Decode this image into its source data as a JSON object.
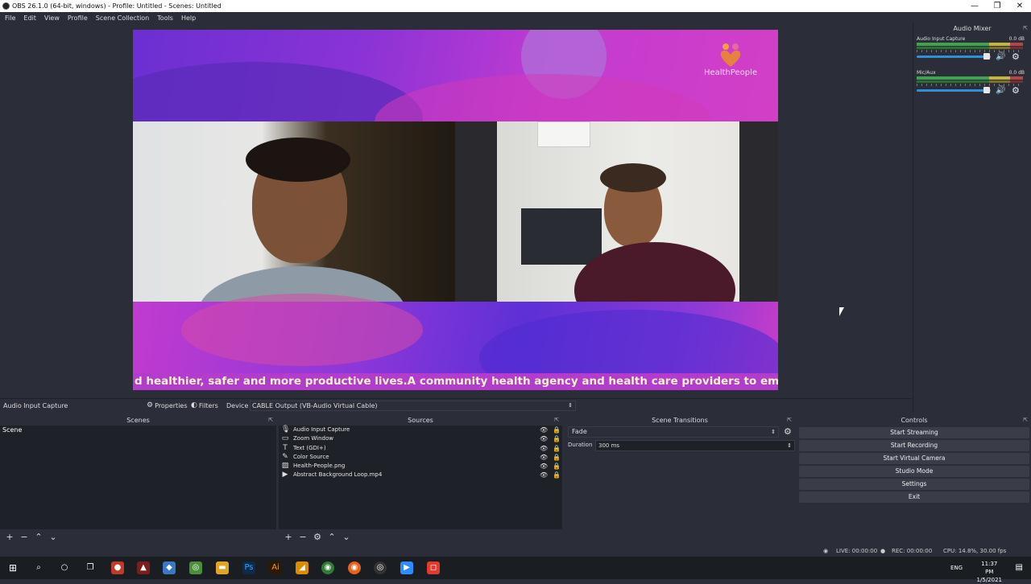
{
  "window": {
    "title": "OBS 26.1.0 (64-bit, windows) - Profile: Untitled - Scenes: Untitled",
    "controls": {
      "minimize": "—",
      "restore": "❐",
      "close": "✕"
    }
  },
  "menu": [
    "File",
    "Edit",
    "View",
    "Profile",
    "Scene Collection",
    "Tools",
    "Help"
  ],
  "preview": {
    "ticker_text": "d healthier, safer and more productive lives.A community health agency and health care providers to empowe",
    "logo_text": "HealthPeople",
    "colors": {
      "purple": "#7a2fd0",
      "magenta": "#d33fc6",
      "ticker_text": "#f4f4c8"
    }
  },
  "audio_mixer": {
    "title": "Audio Mixer",
    "channels": [
      {
        "name": "Audio Input Capture",
        "db": "0.0 dB",
        "volume_icon": "speaker-icon",
        "settings_icon": "gear-icon"
      },
      {
        "name": "Mic/Aux",
        "db": "0.0 dB",
        "volume_icon": "speaker-icon",
        "settings_icon": "gear-icon"
      }
    ]
  },
  "source_toolbar": {
    "selected_source": "Audio Input Capture",
    "properties_label": "Properties",
    "filters_label": "Filters",
    "device_label": "Device",
    "device_value": "CABLE Output (VB-Audio Virtual Cable)"
  },
  "scenes": {
    "title": "Scenes",
    "items": [
      "Scene"
    ]
  },
  "sources": {
    "title": "Sources",
    "items": [
      {
        "label": "Audio Input Capture",
        "icon": "microphone-icon"
      },
      {
        "label": "Zoom Window",
        "icon": "window-icon"
      },
      {
        "label": "Text (GDI+)",
        "icon": "text-icon"
      },
      {
        "label": "Color Source",
        "icon": "paintbrush-icon"
      },
      {
        "label": "Health-People.png",
        "icon": "image-icon"
      },
      {
        "label": "Abstract Background Loop.mp4",
        "icon": "play-icon"
      }
    ]
  },
  "scene_transitions": {
    "title": "Scene Transitions",
    "transition": "Fade",
    "duration_label": "Duration",
    "duration_value": "300 ms"
  },
  "controls": {
    "title": "Controls",
    "buttons": [
      "Start Streaming",
      "Start Recording",
      "Start Virtual Camera",
      "Studio Mode",
      "Settings",
      "Exit"
    ]
  },
  "status": {
    "live": "LIVE: 00:00:00",
    "rec": "REC: 00:00:00",
    "cpu": "CPU: 14.8%, 30.00 fps"
  },
  "taskbar": {
    "language": "ENG",
    "time": "11:37 PM",
    "date": "1/5/2021"
  }
}
